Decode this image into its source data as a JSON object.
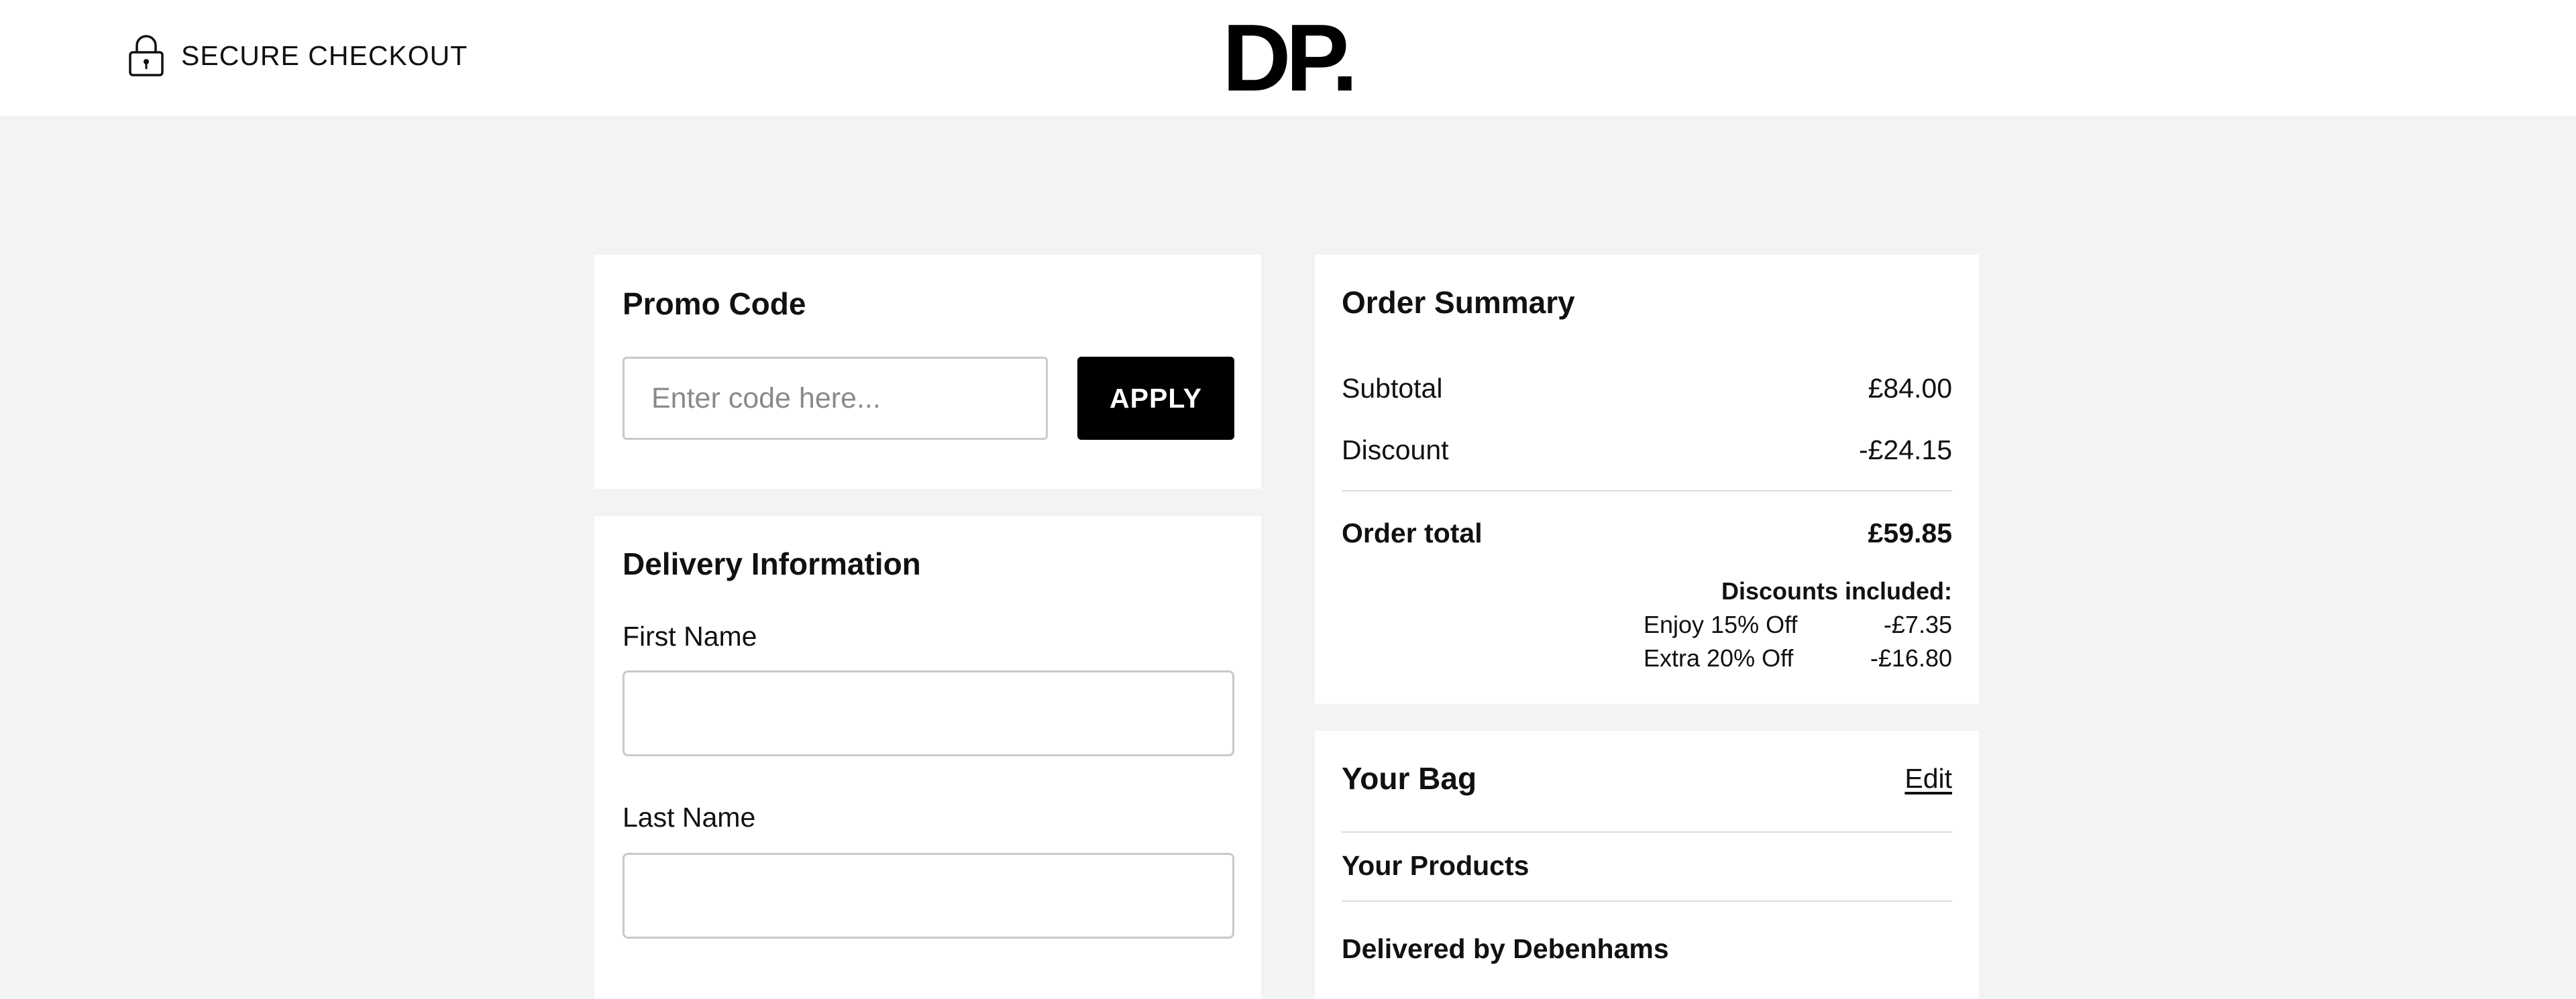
{
  "header": {
    "secure_label": "SECURE CHECKOUT",
    "logo_text": "DP."
  },
  "promo": {
    "title": "Promo Code",
    "placeholder": "Enter code here...",
    "value": "",
    "apply_label": "APPLY"
  },
  "delivery": {
    "title": "Delivery Information",
    "fields": [
      {
        "label": "First Name",
        "value": ""
      },
      {
        "label": "Last Name",
        "value": ""
      }
    ]
  },
  "summary": {
    "title": "Order Summary",
    "subtotal_label": "Subtotal",
    "subtotal_value": "£84.00",
    "discount_label": "Discount",
    "discount_value": "-£24.15",
    "total_label": "Order total",
    "total_value": "£59.85",
    "discounts_included_label": "Discounts included:",
    "discounts": [
      {
        "name": "Enjoy 15% Off",
        "value": "-£7.35"
      },
      {
        "name": "Extra 20% Off",
        "value": "-£16.80"
      }
    ]
  },
  "bag": {
    "title": "Your Bag",
    "edit_label": "Edit",
    "products_label": "Your Products",
    "delivered_by": "Delivered by Debenhams"
  },
  "colors": {
    "page_bg": "#f2f3f4",
    "card_bg": "#ffffff",
    "button_bg": "#000000",
    "text": "#111111"
  }
}
